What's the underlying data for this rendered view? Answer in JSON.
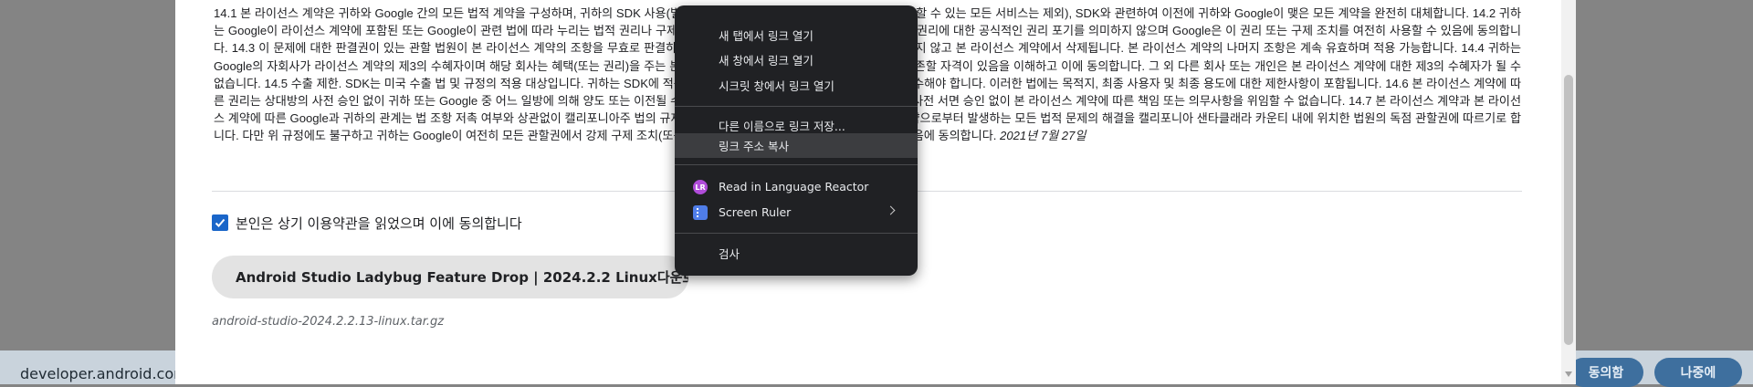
{
  "background": {
    "url": "developer.android.com",
    "agree_button": "동의함",
    "later_button": "나중에"
  },
  "dialog": {
    "terms_text": "14.1 본 라이선스 계약은 귀하와 Google 간의 모든 법적 계약을 구성하며, 귀하의 SDK 사용(별도의 서면 계약에 따라 Google이 귀하에게 제공할 수 있는 모든 서비스는 제외), SDK와 관련하여 이전에 귀하와 Google이 맺은 모든 계약을 완전히 대체합니다. 14.2 귀하는 Google이 라이선스 계약에 포함된 또는 Google이 관련 법에 따라 누리는 법적 권리나 구제 조치를 실행 또는 행사하지 않더라도 Google의 권리에 대한 공식적인 권리 포기를 의미하지 않으며 Google은 이 권리 또는 구제 조치를 여전히 사용할 수 있음에 동의합니다. 14.3 이 문제에 대한 판결권이 있는 관할 법원이 본 라이선스 계약의 조항을 무효로 판결하는 경우 이 조항은 나머지 계약 조항에 영향을 주지 않고 본 라이선스 계약에서 삭제됩니다. 본 라이선스 계약의 나머지 조항은 계속 유효하며 적용 가능합니다. 14.4 귀하는 Google의 자회사가 라이선스 계약의 제3의 수혜자이며 해당 회사는 혜택(또는 권리)을 주는 본 라이선스 계약의 조항을 직접 시행하고 이에 의존할 자격이 있음을 이해하고 이에 동의합니다. 그 외 다른 회사 또는 개인은 본 라이선스 계약에 대한 제3의 수혜자가 될 수 없습니다. 14.5 수출 제한. SDK는 미국 수출 법 및 규정의 적용 대상입니다. 귀하는 SDK에 적용되는 모든 국내 및 국제 수출 법규 및 규정을 준수해야 합니다. 이러한 법에는 목적지, 최종 사용자 및 최종 용도에 대한 제한사항이 포함됩니다. 14.6 본 라이선스 계약에 따른 권리는 상대방의 사전 승인 없이 귀하 또는 Google 중 어느 일방에 의해 양도 또는 이전될 수 없습니다. 또한 귀하 또는 Google은 상대방의 사전 서면 승인 없이 본 라이선스 계약에 따른 책임 또는 의무사항을 위임할 수 없습니다. 14.7 본 라이선스 계약과 본 라이선스 계약에 따른 Google과 귀하의 관계는 법 조항 저촉 여부와 상관없이 캘리포니아주 법의 규제를 받습니다. 귀하와 Google은 본 라이선스 계약으로부터 발생하는 모든 법적 문제의 해결을 캘리포니아 샌타클래라 카운티 내에 위치한 법원의 독점 관할권에 따르기로 합니다. 다만 위 규정에도 불구하고 귀하는 Google이 여전히 모든 관할권에서 강제 구제 조치(또는 동등한 유형의 긴급 법적 구제)를 신청할 수 있음에 동의합니다.",
    "terms_date": "2021년 7월 27일",
    "agree_checkbox_label": "본인은 상기 이용약관을 읽었으며 이에 동의합니다",
    "agree_checked": true,
    "download_button": "Android Studio Ladybug Feature Drop | 2024.2.2 Linux다운로드",
    "filename": "android-studio-2024.2.2.13-linux.tar.gz"
  },
  "context_menu": {
    "items": [
      {
        "label": "새 탭에서 링크 열기"
      },
      {
        "label": "새 창에서 링크 열기"
      },
      {
        "label": "시크릿 창에서 링크 열기"
      },
      {
        "label": "다른 이름으로 링크 저장..."
      },
      {
        "label": "링크 주소 복사",
        "highlighted": true
      },
      {
        "label": "Read in Language Reactor",
        "icon": "language-reactor-icon",
        "icon_text": "LR",
        "icon_color": "#b04cd9"
      },
      {
        "label": "Screen Ruler",
        "icon": "screen-ruler-icon",
        "icon_color": "#4f7de8",
        "has_submenu": true
      },
      {
        "label": "검사"
      }
    ]
  }
}
